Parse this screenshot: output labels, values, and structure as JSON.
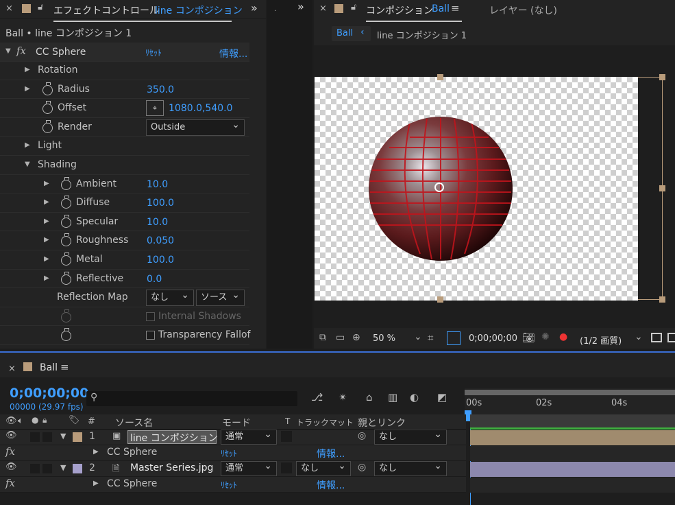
{
  "effects_panel": {
    "tab_title": "エフェクトコントロール",
    "tab_comp": "line コンポジション",
    "header": "Ball • line コンポジション 1",
    "effect_name": "CC Sphere",
    "reset": "ﾘｾｯﾄ",
    "about": "情報...",
    "props": [
      {
        "label": "Rotation"
      },
      {
        "label": "Radius",
        "value": "350.0"
      },
      {
        "label": "Offset",
        "value": "1080.0,540.0"
      },
      {
        "label": "Render",
        "select": "Outside"
      },
      {
        "label": "Light"
      },
      {
        "label": "Shading"
      },
      {
        "label": "Ambient",
        "value": "10.0"
      },
      {
        "label": "Diffuse",
        "value": "100.0"
      },
      {
        "label": "Specular",
        "value": "10.0"
      },
      {
        "label": "Roughness",
        "value": "0.050"
      },
      {
        "label": "Metal",
        "value": "100.0"
      },
      {
        "label": "Reflective",
        "value": "0.0"
      },
      {
        "label": "Reflection Map",
        "select1": "なし",
        "select2": "ソース"
      },
      {
        "label": "Internal Shadows"
      },
      {
        "label": "Transparency Fallof"
      }
    ]
  },
  "comp_panel": {
    "tab_title": "コンポジション",
    "tab_comp": "Ball",
    "layer_label": "レイヤー (なし)",
    "breadcrumb_active": "Ball",
    "breadcrumb_next": "line コンポジション 1",
    "zoom": "50 %",
    "timecode": "0;00;00;00",
    "resolution": "(1/2 画質)"
  },
  "timeline": {
    "tab": "Ball",
    "timecode": "0;00;00;00",
    "fps": "00000 (29.97 fps)",
    "search_placeholder": "",
    "ruler": [
      "00s",
      "02s",
      "04s"
    ],
    "headers": {
      "num": "#",
      "source": "ソース名",
      "mode": "モード",
      "t": "T",
      "trackmatte": "トラックマット",
      "parent": "親とリンク"
    },
    "layers": [
      {
        "num": "1",
        "name": "line コンポジション 1",
        "mode": "通常",
        "parent": "なし",
        "color": "#b99c7b"
      },
      {
        "num": "2",
        "name": "Master Series.jpg",
        "mode": "通常",
        "matte": "なし",
        "parent": "なし",
        "color": "#a6a0cc"
      }
    ],
    "effect_rows": [
      {
        "name": "CC Sphere",
        "reset": "ﾘｾｯﾄ",
        "about": "情報..."
      },
      {
        "name": "CC Sphere",
        "reset": "ﾘｾｯﾄ",
        "about": "情報..."
      }
    ]
  },
  "colors": {
    "accent": "#3f9eff",
    "label_tan": "#b99c7b",
    "label_lavender": "#a6a0cc"
  }
}
